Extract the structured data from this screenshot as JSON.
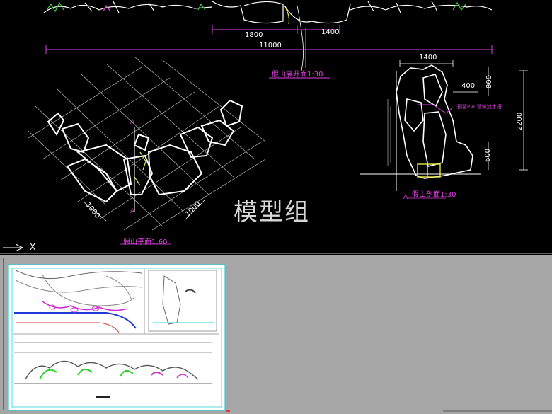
{
  "elevation": {
    "dim_left": "1800",
    "dim_right": "1400",
    "dim_total": "11000",
    "title": "假山展开面1:30"
  },
  "plan": {
    "title": "假山平面1:60",
    "dim_left": "1000",
    "dim_right": "1000",
    "section_mark_top": "A",
    "section_mark_bottom": "A"
  },
  "section": {
    "title": "假山剖面1:30",
    "dim_top": "1400",
    "dim_400": "400",
    "dim_800": "800",
    "dim_2200": "2200",
    "dim_600": "600",
    "callout": "预留PVC管做流水槽",
    "section_mark": "A"
  },
  "watermark": "模型组",
  "ucs_axis_label": "X"
}
